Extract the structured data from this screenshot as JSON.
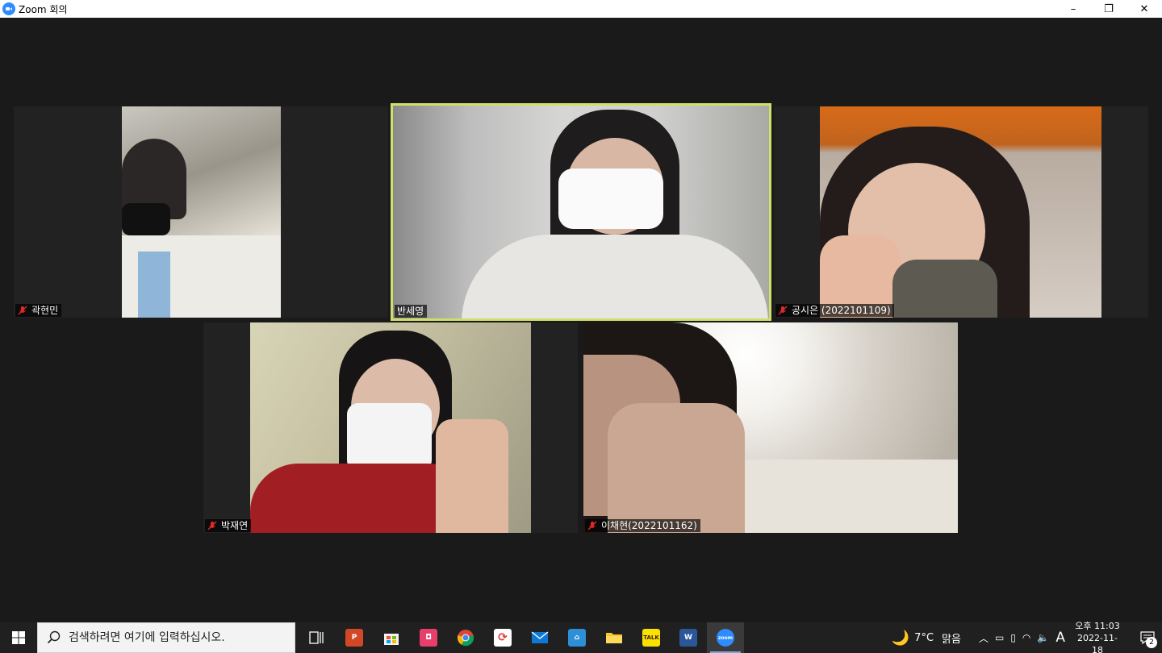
{
  "window": {
    "title": "Zoom 회의",
    "minimize": "–",
    "restore": "❐",
    "close": "✕"
  },
  "participants": [
    {
      "name": "곽현민",
      "muted": true
    },
    {
      "name": "반세영",
      "muted": false,
      "active_speaker": true
    },
    {
      "name": "공시은 (2022101109)",
      "muted": true
    },
    {
      "name": "박재연",
      "muted": true
    },
    {
      "name": "이채현(2022101162)",
      "muted": true
    }
  ],
  "taskbar": {
    "search_placeholder": "검색하려면 여기에 입력하십시오.",
    "apps": [
      "task-view",
      "powerpoint",
      "store",
      "app-pink",
      "chrome",
      "sync-app",
      "mail",
      "ime-app",
      "file-explorer",
      "kakaotalk",
      "word",
      "zoom"
    ],
    "kakaotalk_label": "TALK",
    "zoom_label": "zoom",
    "word_label": "W",
    "weather": {
      "temp": "7°C",
      "condition": "맑음"
    },
    "ime_indicator": "A",
    "clock": {
      "time": "오후 11:03",
      "date": "2022-11-18"
    },
    "notification_count": "2"
  }
}
